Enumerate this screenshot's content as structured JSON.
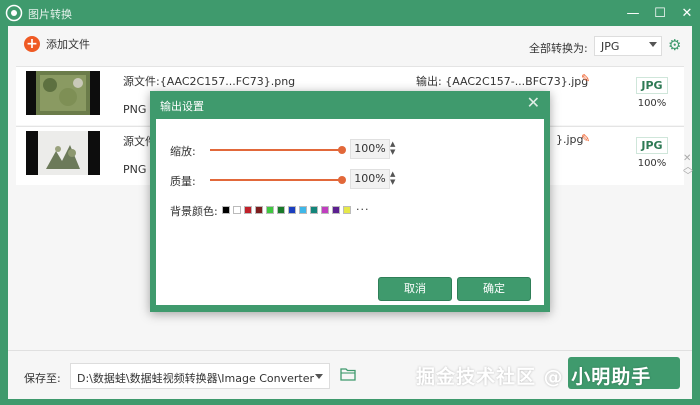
{
  "window": {
    "title": "图片转换",
    "minimize": "—",
    "maximize": "☐",
    "close": "✕"
  },
  "toolbar": {
    "add_files_label": "添加文件",
    "convert_all_label": "全部转换为:",
    "format_selected": "JPG"
  },
  "files": [
    {
      "source_text": "源文件:{AAC2C157...FC73}.png",
      "output_text": "输出: {AAC2C157-...BFC73}.jpg",
      "input_format": "PNG",
      "output_format": "JPG",
      "quality": "100%"
    },
    {
      "source_text": "源文件",
      "output_text": "}.jpg",
      "input_format": "PNG",
      "output_format": "JPG",
      "quality": "100%"
    }
  ],
  "dialog": {
    "title": "输出设置",
    "close": "✕",
    "scale_label": "缩放:",
    "scale_value": "100%",
    "quality_label": "质量:",
    "quality_value": "100%",
    "background_label": "背景颜色:",
    "more_colors": "···",
    "cancel_label": "取消",
    "ok_label": "确定",
    "swatch_colors": [
      "#000000",
      "#ffffff",
      "#c0202a",
      "#7b1d1d",
      "#40c840",
      "#1a7a2a",
      "#1b3fbf",
      "#3fb7e8",
      "#13857a",
      "#c03fbf",
      "#5b1f8f",
      "#e6e84a"
    ]
  },
  "bottom": {
    "save_to_label": "保存至:",
    "save_path": "D:\\数据蛙\\数据蛙视频转换器\\Image Converter"
  },
  "watermark": "掘金技术社区 @ 小明助手",
  "colors": {
    "accent_green": "#3f9a6d",
    "accent_orange": "#ef5a24"
  }
}
